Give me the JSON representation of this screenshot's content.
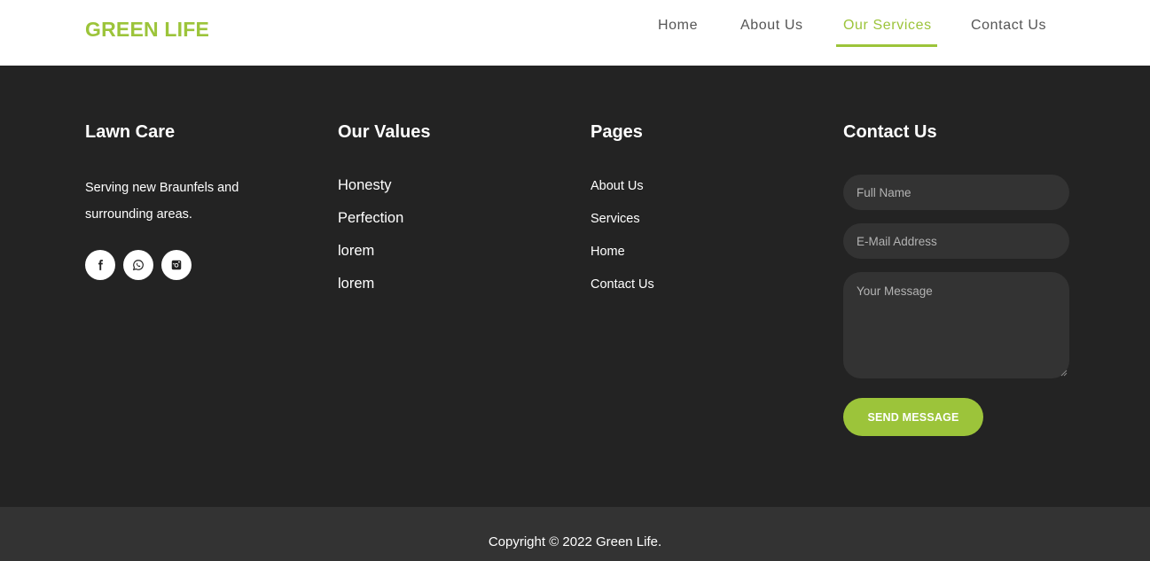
{
  "header": {
    "logo": "GREEN LIFE",
    "nav": [
      {
        "label": "Home",
        "active": false
      },
      {
        "label": "About Us",
        "active": false
      },
      {
        "label": "Our Services",
        "active": true
      },
      {
        "label": "Contact Us",
        "active": false
      }
    ]
  },
  "footer": {
    "lawn_care": {
      "title": "Lawn Care",
      "description": "Serving new Braunfels and surrounding areas.",
      "socials": [
        {
          "icon": "facebook-icon"
        },
        {
          "icon": "whatsapp-icon"
        },
        {
          "icon": "instagram-icon"
        }
      ]
    },
    "values": {
      "title": "Our Values",
      "items": [
        "Honesty",
        "Perfection",
        "lorem",
        "lorem"
      ]
    },
    "pages": {
      "title": "Pages",
      "items": [
        "About Us",
        "Services",
        "Home",
        "Contact Us"
      ]
    },
    "contact": {
      "title": "Contact Us",
      "name_placeholder": "Full Name",
      "email_placeholder": "E-Mail Address",
      "message_placeholder": "Your Message",
      "button": "SEND MESSAGE"
    }
  },
  "bottom": {
    "copyright": "Copyright © 2022 Green Life."
  },
  "colors": {
    "accent": "#9cc43a",
    "footer_bg": "#232323",
    "bottom_bg": "#333333"
  }
}
